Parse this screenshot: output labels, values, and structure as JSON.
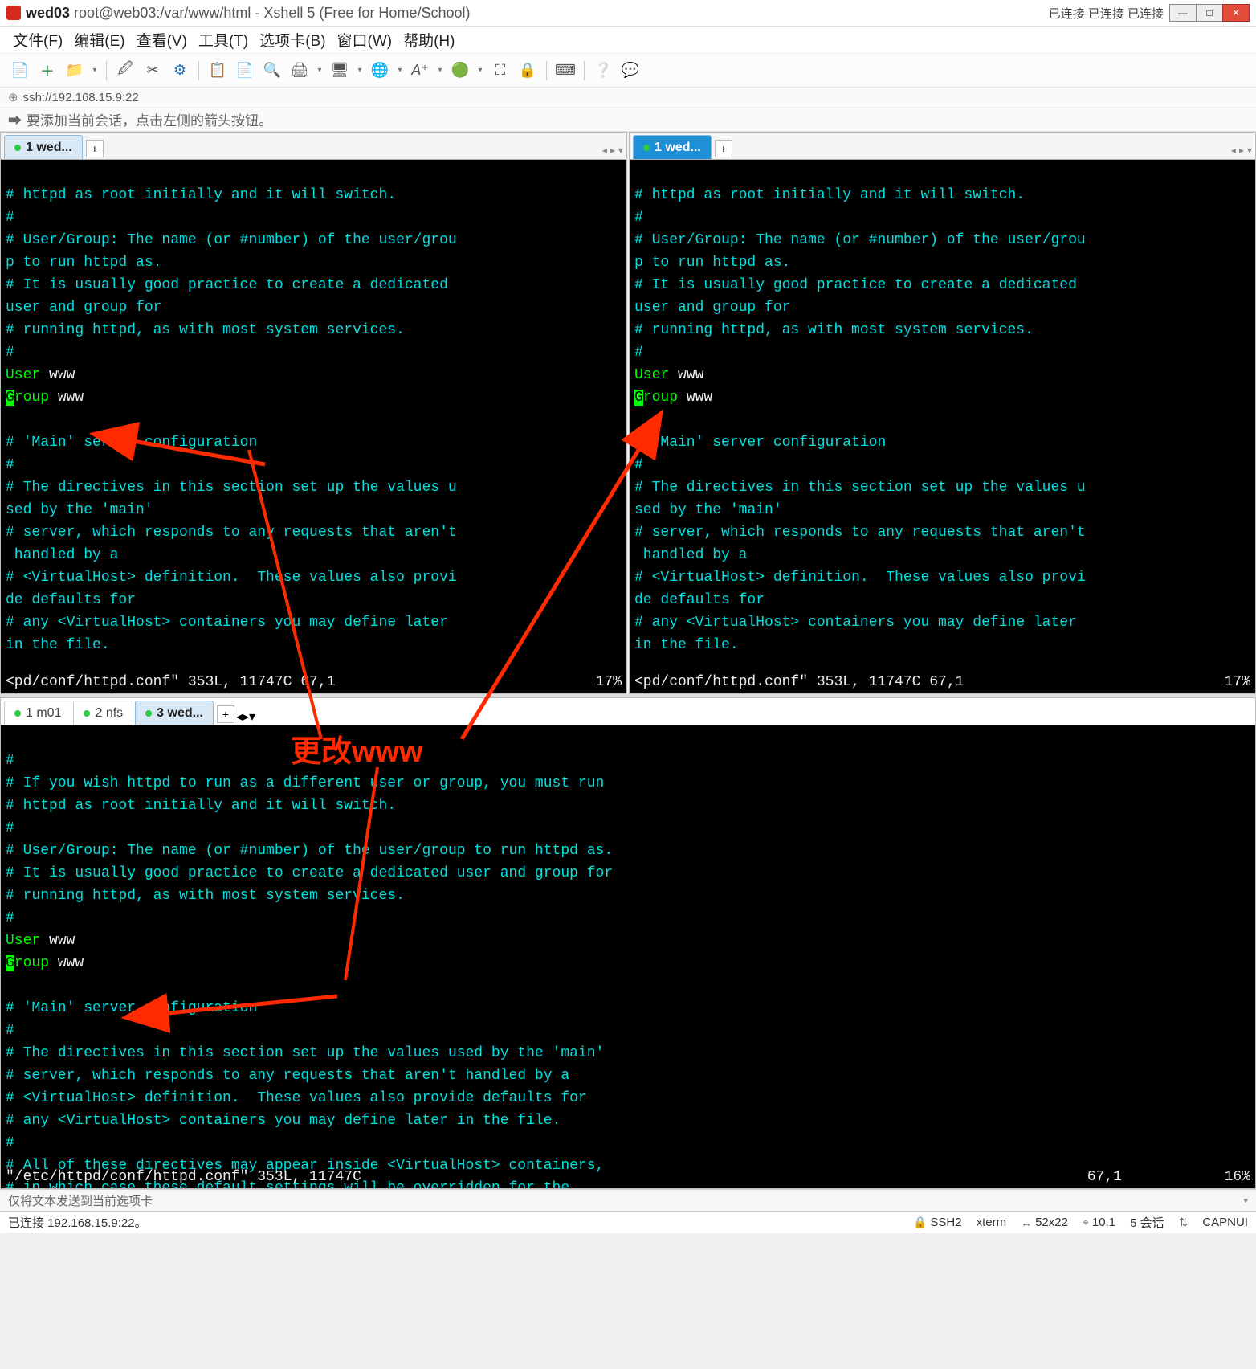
{
  "titlebar": {
    "title_bold": "wed03",
    "title_rest": "root@web03:/var/www/html - Xshell 5 (Free for Home/School)",
    "status": "已连接 已连接 已连接"
  },
  "winbuttons": {
    "min": "—",
    "max": "□",
    "close": "✕"
  },
  "menu": {
    "file": "文件(F)",
    "edit": "编辑(E)",
    "view": "查看(V)",
    "tools": "工具(T)",
    "tabs": "选项卡(B)",
    "window": "窗口(W)",
    "help": "帮助(H)"
  },
  "address": "ssh://192.168.15.9:22",
  "hint": "要添加当前会话，点击左侧的箭头按钮。",
  "tabs_top": {
    "left": "1 wed...",
    "right": "1 wed..."
  },
  "tabs_bottom": {
    "t1": "1 m01",
    "t2": "2 nfs",
    "t3": "3 wed..."
  },
  "annotation": "更改www",
  "term_top": {
    "l1": "# httpd as root initially and it will switch.",
    "l2": "#",
    "l3": "# User/Group: The name (or #number) of the user/grou",
    "l4": "p to run httpd as.",
    "l5": "# It is usually good practice to create a dedicated ",
    "l6": "user and group for",
    "l7": "# running httpd, as with most system services.",
    "l8": "#",
    "l9a": "User",
    "l9b": " www",
    "l10a": "G",
    "l10b": "roup",
    "l10c": " www",
    "l11": "",
    "l12": "# 'Main' server configuration",
    "l13": "#",
    "l14": "# The directives in this section set up the values u",
    "l15": "sed by the 'main'",
    "l16": "# server, which responds to any requests that aren't",
    "l17": " handled by a",
    "l18": "# <VirtualHost> definition.  These values also provi",
    "l19": "de defaults for",
    "l20": "# any <VirtualHost> containers you may define later ",
    "l21": "in the file.",
    "status_left": "<pd/conf/httpd.conf\" 353L, 11747C 67,1",
    "status_right": "17%"
  },
  "term_bottom": {
    "l0": "#",
    "l1": "# If you wish httpd to run as a different user or group, you must run",
    "l2": "# httpd as root initially and it will switch.",
    "l3": "#",
    "l4": "# User/Group: The name (or #number) of the user/group to run httpd as.",
    "l5": "# It is usually good practice to create a dedicated user and group for",
    "l6": "# running httpd, as with most system services.",
    "l7": "#",
    "l8a": "User",
    "l8b": " www",
    "l9a": "G",
    "l9b": "roup",
    "l9c": " www",
    "l10": "",
    "l11": "# 'Main' server configuration",
    "l12": "#",
    "l13": "# The directives in this section set up the values used by the 'main'",
    "l14": "# server, which responds to any requests that aren't handled by a",
    "l15": "# <VirtualHost> definition.  These values also provide defaults for",
    "l16": "# any <VirtualHost> containers you may define later in the file.",
    "l17": "#",
    "l18": "# All of these directives may appear inside <VirtualHost> containers,",
    "l19": "# in which case these default settings will be overridden for the",
    "status_left": "\"/etc/httpd/conf/httpd.conf\" 353L, 11747C",
    "status_mid": "67,1",
    "status_right": "16%"
  },
  "footer1": "仅将文本发送到当前选项卡",
  "footer2": {
    "conn": "已连接 192.168.15.9:22。",
    "ssh": "SSH2",
    "term": "xterm",
    "size": "52x22",
    "cursor": "10,1",
    "sessions": "5 会话",
    "ime": "CAPNUI"
  }
}
